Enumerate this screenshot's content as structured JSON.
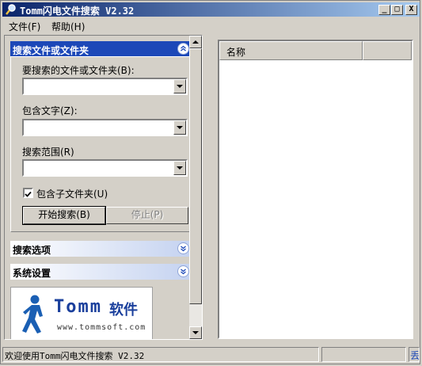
{
  "window": {
    "title": "Tomm闪电文件搜索 V2.32",
    "controls": {
      "minimize": "_",
      "maximize": "□",
      "close": "X"
    }
  },
  "menu": [
    {
      "label": "文件(F)"
    },
    {
      "label": "帮助(H)"
    }
  ],
  "search_panel": {
    "header": "搜索文件或文件夹",
    "name_label": "要搜索的文件或文件夹(B):",
    "name_value": "",
    "text_label": "包含文字(Z):",
    "text_value": "",
    "scope_label": "搜索范围(R)",
    "scope_value": "",
    "subfolders_label": "包含子文件夹(U)",
    "subfolders_checked": true,
    "start_button": "开始搜索(B)",
    "stop_button": "停止(P)"
  },
  "options_panel": {
    "header": "搜索选项"
  },
  "settings_panel": {
    "header": "系统设置"
  },
  "logo": {
    "brand": "Tomm",
    "brand_cn": "软件",
    "url": "www.tommsoft.com"
  },
  "results": {
    "columns": [
      "名称",
      ""
    ]
  },
  "status": {
    "message": "欢迎使用Tomm闪电文件搜索 V2.32",
    "right_text": "丢"
  },
  "colors": {
    "accent": "#1c48b8",
    "title_start": "#0a246a",
    "title_end": "#a6caf0",
    "logo_text": "#1a3f9c"
  }
}
